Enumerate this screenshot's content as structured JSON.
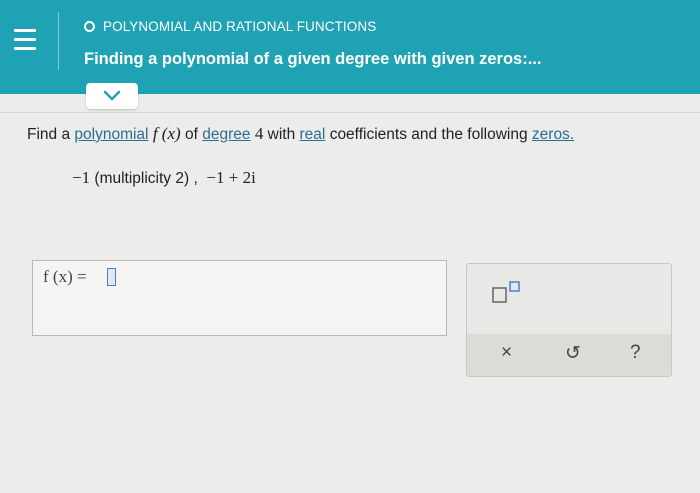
{
  "header": {
    "menu_icon": "hamburger-icon",
    "topic": "POLYNOMIAL AND RATIONAL FUNCTIONS",
    "title": "Finding a polynomial of a given degree with given zeros:...",
    "collapse_icon": "chevron-down-icon",
    "bg_color": "#1fa3b4"
  },
  "question": {
    "find_a": "Find a",
    "polynomial": "polynomial",
    "fx": "f (x)",
    "of": "of",
    "degree": "degree",
    "degree_value": "4",
    "with": "with",
    "real": "real",
    "coefficients": "coefficients and the following",
    "zeros": "zeros.",
    "zero1": "−1",
    "multiplicity": "(multiplicity 2) ,",
    "zero2": "−1 + 2i"
  },
  "answer": {
    "label": "f (x)  =",
    "value": ""
  },
  "tools": {
    "exponent_icon": "exponent-template-icon",
    "clear_label": "×",
    "undo_label": "↺",
    "help_label": "?"
  },
  "colors": {
    "link": "#2b6f93",
    "accent": "#1fa3b4"
  }
}
